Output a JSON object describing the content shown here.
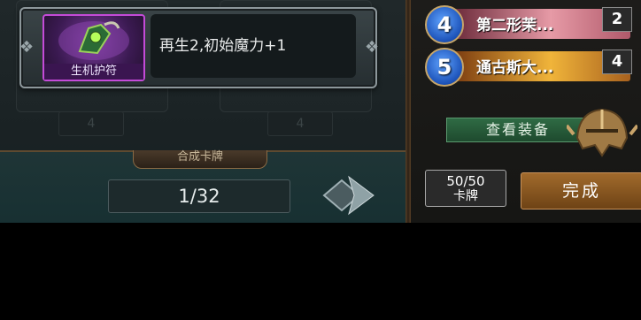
{
  "item": {
    "name": "生机护符",
    "description": "再生2,初始魔力+1"
  },
  "ghost_counts": [
    "4",
    "4"
  ],
  "merge_tab": {
    "label": "合成卡牌"
  },
  "pager": {
    "text": "1/32"
  },
  "deck": [
    {
      "mana": "4",
      "name": "第二形茉...",
      "count": "2"
    },
    {
      "mana": "5",
      "name": "通古斯大...",
      "count": "4"
    }
  ],
  "equip_button": {
    "label": "查看装备"
  },
  "card_count": {
    "value": "50/50",
    "label": "卡牌"
  },
  "done_button": {
    "label": "完成"
  },
  "colors": {
    "accent_gold": "#c6a569",
    "item_frame": "#c44bd8",
    "done": "#a16a2c",
    "equip": "#2f6b44",
    "mana": "#1c52b8"
  },
  "icons": {
    "item": "amulet-icon",
    "helm": "helmet-icon",
    "next": "arrow-right-icon"
  }
}
